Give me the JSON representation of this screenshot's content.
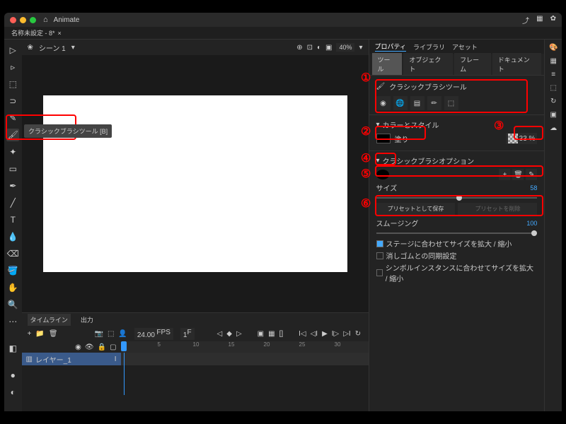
{
  "app": {
    "name": "Animate",
    "doc_title": "名称未設定 - 8*",
    "scene": "シーン 1",
    "zoom": "40%"
  },
  "titlebar": {
    "share_icon": "⤴",
    "grid_icon": "▦",
    "settings_icon": "✿"
  },
  "tooltip": {
    "brush": "クラシックブラシツール [B]"
  },
  "properties": {
    "tab_properties": "プロパティ",
    "tab_library": "ライブラリ",
    "tab_assets": "アセット",
    "subtab_tool": "ツール",
    "subtab_object": "オブジェクト",
    "subtab_frame": "フレーム",
    "subtab_document": "ドキュメント",
    "tool_name": "クラシックブラシツール",
    "section_color": "カラーとスタイル",
    "fill_label": "塗り",
    "opacity_value": "33 %",
    "section_brush": "クラシックブラシオプション",
    "size_label": "サイズ",
    "size_value": "58",
    "preset_save": "プリセットとして保存",
    "preset_delete": "プリセットを削除",
    "smoothing_label": "スムージング",
    "smoothing_value": "100",
    "cb_stage": "ステージに合わせてサイズを拡大 / 縮小",
    "cb_eraser": "消しゴムとの同期設定",
    "cb_symbol": "シンボルインスタンスに合わせてサイズを拡大 / 縮小"
  },
  "timeline": {
    "tab_timeline": "タイムライン",
    "tab_output": "出力",
    "fps": "24.00",
    "fps_label": "FPS",
    "frame_num": "1",
    "layer1": "レイヤー_1",
    "ticks": [
      "",
      "5",
      "10",
      "15",
      "20",
      "25",
      "30"
    ]
  }
}
